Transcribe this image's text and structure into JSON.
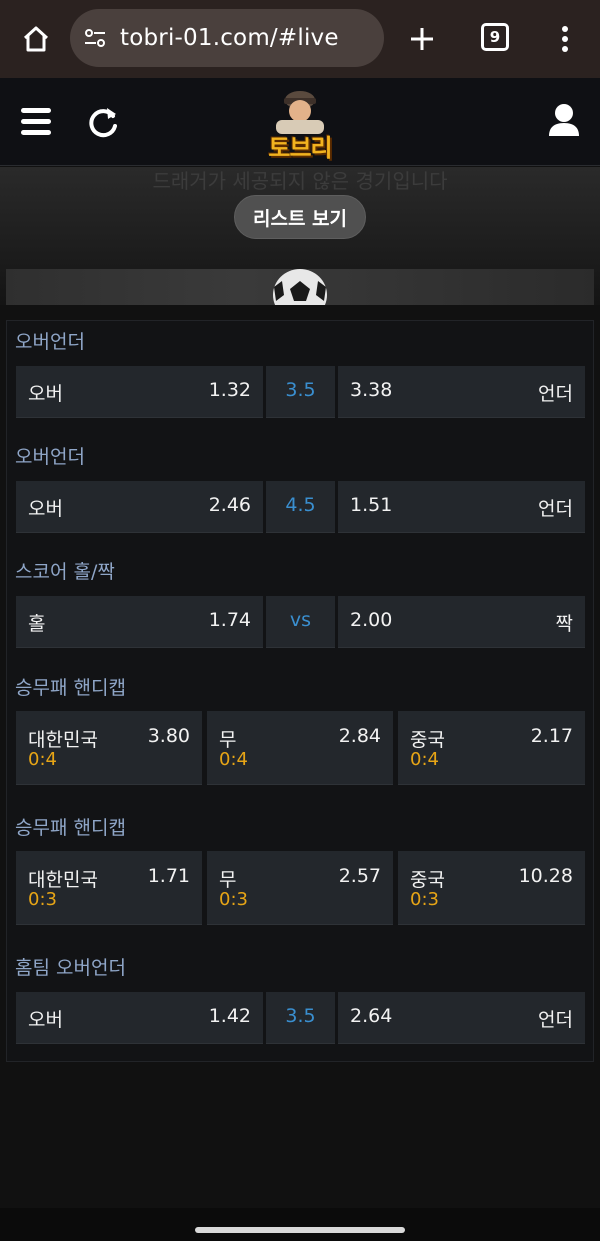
{
  "browser": {
    "url": "tobri-01.com/#live",
    "tab_count": "9"
  },
  "header": {
    "logo_text": "토브리"
  },
  "banner": {
    "faded_text": "드래거가 세공되지 않은 경기입니다",
    "list_button": "리스트 보기"
  },
  "markets": [
    {
      "title": "오버언더",
      "left_label": "오버",
      "left_odd": "1.32",
      "center": "3.5",
      "right_odd": "3.38",
      "right_label": "언더"
    },
    {
      "title": "오버언더",
      "left_label": "오버",
      "left_odd": "2.46",
      "center": "4.5",
      "right_odd": "1.51",
      "right_label": "언더"
    },
    {
      "title": "스코어 홀/짝",
      "left_label": "홀",
      "left_odd": "1.74",
      "center": "vs",
      "right_odd": "2.00",
      "right_label": "짝"
    },
    {
      "title": "승무패 핸디캡",
      "options": [
        {
          "label": "대한민국",
          "odd": "3.80",
          "handicap": "0:4"
        },
        {
          "label": "무",
          "odd": "2.84",
          "handicap": "0:4"
        },
        {
          "label": "중국",
          "odd": "2.17",
          "handicap": "0:4"
        }
      ]
    },
    {
      "title": "승무패 핸디캡",
      "options": [
        {
          "label": "대한민국",
          "odd": "1.71",
          "handicap": "0:3"
        },
        {
          "label": "무",
          "odd": "2.57",
          "handicap": "0:3"
        },
        {
          "label": "중국",
          "odd": "10.28",
          "handicap": "0:3"
        }
      ]
    },
    {
      "title": "홈팀 오버언더",
      "left_label": "오버",
      "left_odd": "1.42",
      "center": "3.5",
      "right_odd": "2.64",
      "right_label": "언더"
    }
  ],
  "colors": {
    "market_title": "#8fa6c8",
    "center_value": "#3a8fd0",
    "handicap": "#e7a516",
    "logo": "#f2b31f"
  }
}
